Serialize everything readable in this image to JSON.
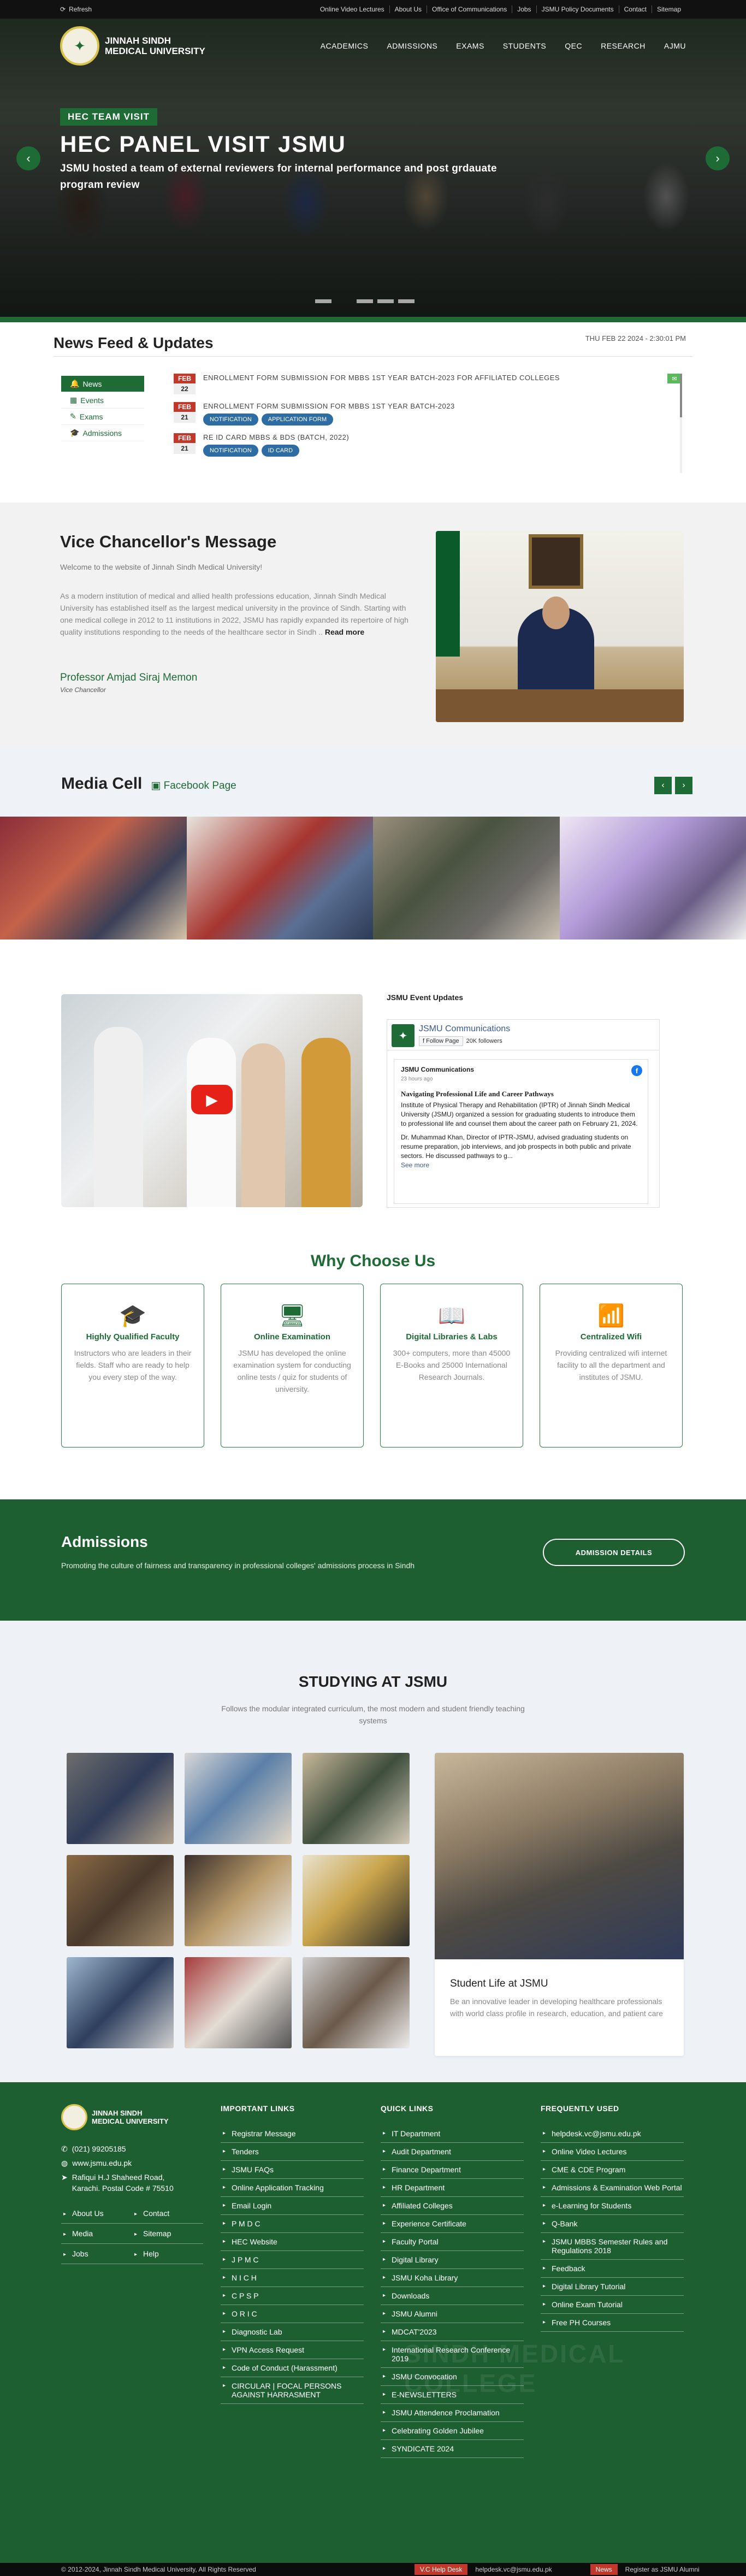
{
  "topbar": {
    "refresh": "Refresh",
    "links": [
      "Online Video Lectures",
      "About Us",
      "Office of Communications",
      "Jobs",
      "JSMU Policy Documents",
      "Contact",
      "Sitemap"
    ]
  },
  "header": {
    "logo_line1": "JINNAH SINDH",
    "logo_line2": "MEDICAL UNIVERSITY",
    "menu": [
      "ACADEMICS",
      "ADMISSIONS",
      "EXAMS",
      "STUDENTS",
      "QEC",
      "RESEARCH",
      "AJMU"
    ]
  },
  "hero": {
    "badge": "HEC TEAM VISIT",
    "title": "HEC PANEL VISIT JSMU",
    "subtitle": "JSMU hosted a team of external reviewers for internal performance and post grdauate program review"
  },
  "news": {
    "title": "News Feed & Updates",
    "date": "THU FEB 22 2024 - 2:30:01 PM",
    "tabs": [
      "News",
      "Events",
      "Exams",
      "Admissions"
    ],
    "items": [
      {
        "month": "FEB",
        "day": "22",
        "title": "ENROLLMENT FORM SUBMISSION FOR MBBS 1ST YEAR BATCH-2023 FOR AFFILIATED COLLEGES",
        "tags": []
      },
      {
        "month": "FEB",
        "day": "21",
        "title": "ENROLLMENT FORM SUBMISSION FOR MBBS 1ST YEAR BATCH-2023",
        "tags": [
          "NOTIFICATION",
          "APPLICATION FORM"
        ]
      },
      {
        "month": "FEB",
        "day": "21",
        "title": "RE ID CARD MBBS & BDS (BATCH, 2022)",
        "tags": [
          "NOTIFICATION",
          "ID CARD"
        ]
      }
    ]
  },
  "vc": {
    "title": "Vice Chancellor's Message",
    "welcome": "Welcome to the website of Jinnah Sindh Medical University!",
    "body": "As a modern institution of medical and allied health professions education, Jinnah Sindh Medical University has established itself as the largest medical university in the province of Sindh. Starting with one medical college in 2012 to 11 institutions in 2022, JSMU has rapidly expanded its repertoire of high quality institutions responding to the needs of the healthcare sector in Sindh .. ",
    "read_more": "Read more",
    "name": "Professor Amjad Siraj Memon",
    "role": "Vice Chancellor"
  },
  "media": {
    "title": "Media Cell",
    "fb_link": "Facebook Page"
  },
  "events": {
    "label": "JSMU Event Updates",
    "page_name": "JSMU Communications",
    "follow": "Follow Page",
    "followers": "20K followers",
    "post_author": "JSMU Communications",
    "post_time": "23 hours ago",
    "post_title": "Navigating Professional Life and Career Pathways",
    "post_p1": "Institute of Physical Therapy and Rehabilitation (IPTR) of Jinnah Sindh Medical University (JSMU) organized a session for graduating students to introduce them to professional life and counsel them about the career path on February 21, 2024.",
    "post_p2": "Dr. Muhammad Khan, Director of IPTR-JSMU, advised graduating students on resume preparation, job interviews, and job prospects in both public and private sectors. He discussed pathways to g...",
    "see_more": "See more"
  },
  "why": {
    "title": "Why Choose Us",
    "cards": [
      {
        "title": "Highly Qualified Faculty",
        "desc": "Instructors who are leaders in their fields. Staff who are ready to help you every step of the way."
      },
      {
        "title": "Online Examination",
        "desc": "JSMU has developed the online examination system for conducting online tests / quiz for students of university."
      },
      {
        "title": "Digital Libraries & Labs",
        "desc": "300+ computers, more than 45000 E-Books and 25000 International Research Journals."
      },
      {
        "title": "Centralized Wifi",
        "desc": "Providing centralized wifi internet facility to all the department and institutes of JSMU."
      }
    ]
  },
  "admissions": {
    "title": "Admissions",
    "desc": "Promoting the culture of fairness and transparency in professional colleges' admissions process in Sindh",
    "button": "ADMISSION DETAILS"
  },
  "study": {
    "title": "STUDYING AT JSMU",
    "sub": "Follows the modular integrated curriculum, the most modern and student friendly teaching systems",
    "card_title": "Student Life at JSMU",
    "card_desc": "Be an innovative leader in developing healthcare professionals with world class profile in research, education, and patient care"
  },
  "footer": {
    "phone": "(021) 99205185",
    "web": "www.jsmu.edu.pk",
    "address": "Rafiqui H.J Shaheed Road, Karachi. Postal Code # 75510",
    "links": [
      "About Us",
      "Contact",
      "Media",
      "Sitemap",
      "Jobs",
      "Help"
    ],
    "important_title": "IMPORTANT LINKS",
    "important": [
      "Registrar Message",
      "Tenders",
      "JSMU FAQs",
      "Online Application Tracking",
      "Email Login",
      "P M D C",
      "HEC Website",
      "J P M C",
      "N I C H",
      "C P S P",
      "O R I C",
      "Diagnostic Lab",
      "VPN Access Request",
      "Code of Conduct (Harassment)",
      "CIRCULAR | FOCAL PERSONS AGAINST HARRASMENT"
    ],
    "quick_title": "QUICK LINKS",
    "quick": [
      "IT Department",
      "Audit Department",
      "Finance Department",
      "HR Department",
      "Affiliated Colleges",
      "Experience Certificate",
      "Faculty Portal",
      "Digital Library",
      "JSMU Koha Library",
      "Downloads",
      "JSMU Alumni",
      "MDCAT'2023",
      "International Research Conference 2019",
      "JSMU Convocation",
      "E-NEWSLETTERS",
      "JSMU Attendence Proclamation",
      "Celebrating Golden Jubilee",
      "SYNDICATE 2024"
    ],
    "freq_title": "FREQUENTLY USED",
    "freq": [
      "helpdesk.vc@jsmu.edu.pk",
      "Online Video Lectures",
      "CME & CDE Program",
      "Admissions & Examination Web Portal",
      "e-Learning for Students",
      "Q-Bank",
      "JSMU MBBS Semester Rules and Regulations 2018",
      "Feedback",
      "Digital Library Tutorial",
      "Online Exam Tutorial",
      "Free PH Courses"
    ],
    "watermark": "SINDH MEDICAL COLLEGE"
  },
  "bottombar": {
    "copy": "© 2012-2024, Jinnah Sindh Medical University, All Rights Reserved",
    "helpdesk": "V.C Help Desk",
    "email": "helpdesk.vc@jsmu.edu.pk",
    "news": "News",
    "alumni": "Register as JSMU Alumni"
  }
}
